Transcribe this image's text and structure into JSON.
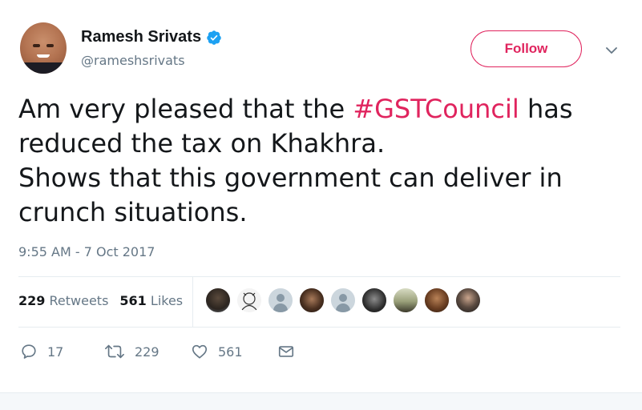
{
  "user": {
    "name": "Ramesh Srivats",
    "handle": "@rameshsrivats",
    "verified": true
  },
  "follow_label": "Follow",
  "tweet": {
    "lines": [
      {
        "before": "Am very pleased that the ",
        "hashtag": "#GSTCouncil",
        "after": " has"
      },
      {
        "text": "reduced the tax on Khakhra."
      },
      {
        "text": "Shows that this government can deliver in"
      },
      {
        "text": "crunch situations."
      }
    ]
  },
  "timestamp": "9:55 AM - 7 Oct 2017",
  "stats": {
    "retweets_count": "229",
    "retweets_label": "Retweets",
    "likes_count": "561",
    "likes_label": "Likes"
  },
  "liker_avatars": [
    "photo",
    "sketch",
    "default",
    "photo",
    "default",
    "photo",
    "photo",
    "photo",
    "photo"
  ],
  "actions": {
    "replies": "17",
    "retweets": "229",
    "likes": "561"
  },
  "colors": {
    "accent": "#e0245e",
    "verified": "#1da1f2",
    "text": "#14171a",
    "secondary": "#657786"
  }
}
